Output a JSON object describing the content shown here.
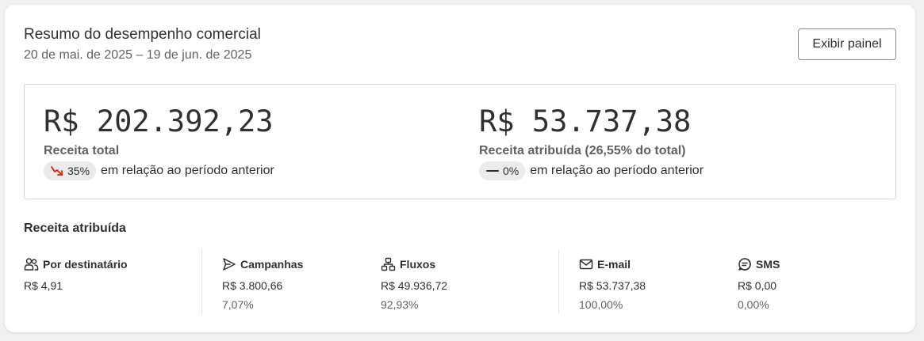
{
  "header": {
    "title": "Resumo do desempenho comercial",
    "date_range": "20 de mai. de 2025 – 19 de jun. de 2025",
    "panel_button": "Exibir painel"
  },
  "summary": {
    "total": {
      "value": "R$ 202.392,23",
      "label": "Receita total",
      "change": "35%",
      "change_icon": "trend-down-icon",
      "change_color": "#e51c00",
      "comparison": "em relação ao período anterior"
    },
    "attributed": {
      "value": "R$ 53.737,38",
      "label": "Receita atribuída (26,55% do total)",
      "change": "0%",
      "change_icon": "dash-icon",
      "comparison": "em relação ao período anterior"
    }
  },
  "breakdown": {
    "title": "Receita atribuída",
    "items": [
      {
        "icon": "people-icon",
        "label": "Por destinatário",
        "value": "R$ 4,91",
        "percent": ""
      },
      {
        "icon": "send-icon",
        "label": "Campanhas",
        "value": "R$ 3.800,66",
        "percent": "7,07%"
      },
      {
        "icon": "flow-icon",
        "label": "Fluxos",
        "value": "R$ 49.936,72",
        "percent": "92,93%"
      },
      {
        "icon": "email-icon",
        "label": "E-mail",
        "value": "R$ 53.737,38",
        "percent": "100,00%"
      },
      {
        "icon": "sms-icon",
        "label": "SMS",
        "value": "R$ 0,00",
        "percent": "0,00%"
      }
    ]
  }
}
